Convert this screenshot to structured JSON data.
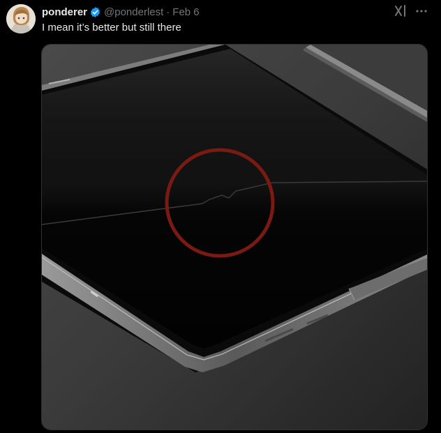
{
  "tweet": {
    "display_name": "ponderer",
    "handle": "@ponderlest",
    "separator": "·",
    "date": "Feb 6",
    "text": "I mean it’s better but still there"
  },
  "icons": {
    "verified": "verified-badge-icon",
    "grok": "grok-icon",
    "more": "more-options-icon"
  },
  "colors": {
    "verified": "#1d9bf0",
    "secondary_text": "#71767b",
    "primary_text": "#e7e9ea",
    "highlight_circle": "#7a1a12"
  }
}
